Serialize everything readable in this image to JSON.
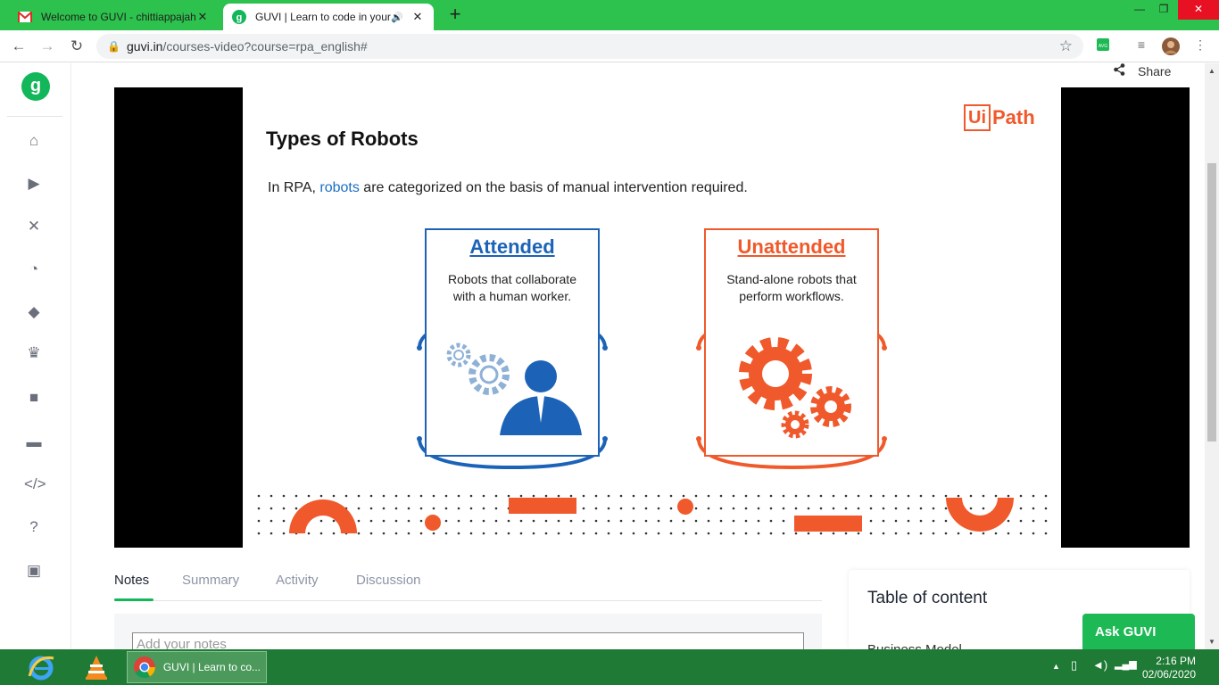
{
  "browser": {
    "tabs": [
      {
        "title": "Welcome to GUVI - chittiappajah",
        "favicon": "gmail-icon",
        "active": false
      },
      {
        "title": "GUVI | Learn to code in your",
        "favicon": "guvi-icon",
        "active": true,
        "audio": true
      }
    ],
    "url_host": "guvi.in",
    "url_path": "/courses-video?course=rpa_english#"
  },
  "header": {
    "share_label": "Share"
  },
  "slide": {
    "brand_box": "Ui",
    "brand_text": "Path",
    "title": "Types of Robots",
    "sub_pre": "In RPA, ",
    "sub_hl": "robots",
    "sub_post": " are categorized on the basis of manual intervention required.",
    "attended": {
      "title": "Attended",
      "desc_1": "Robots that collaborate",
      "desc_2": "with a human worker."
    },
    "unattended": {
      "title": "Unattended",
      "desc_1": "Stand-alone robots that",
      "desc_2": "perform workflows."
    },
    "colors": {
      "blue": "#1c63b7",
      "orange": "#f0592b"
    }
  },
  "notes_tabs": [
    {
      "label": "Notes",
      "active": true
    },
    {
      "label": "Summary",
      "active": false
    },
    {
      "label": "Activity",
      "active": false
    },
    {
      "label": "Discussion",
      "active": false
    }
  ],
  "notes": {
    "placeholder": "Add your notes"
  },
  "toc": {
    "title": "Table of content",
    "first_item": "Business Model"
  },
  "ask_guvi": "Ask GUVI",
  "taskbar": {
    "chrome_label": "GUVI | Learn to co...",
    "time": "2:16 PM",
    "date": "02/06/2020"
  },
  "accent": "#11b759"
}
